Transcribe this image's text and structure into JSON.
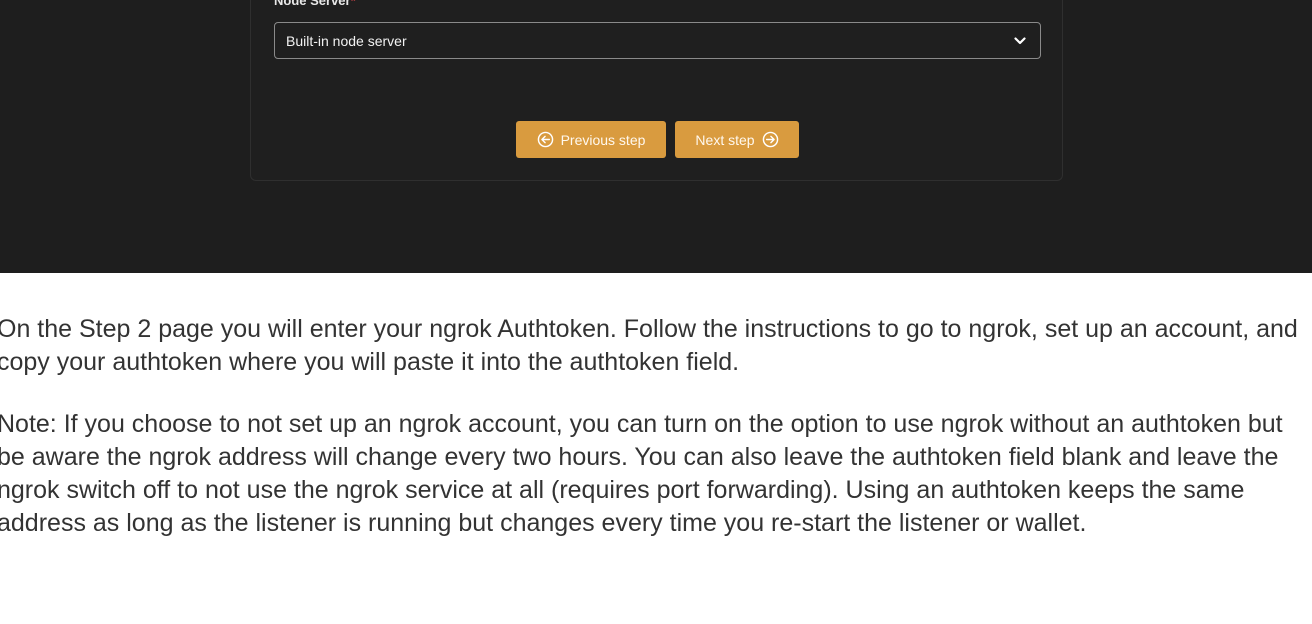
{
  "form": {
    "field_label": "Node Server",
    "required_mark": "*",
    "select": {
      "value": "Built-in node server",
      "icon": "chevron-down-icon"
    },
    "buttons": {
      "previous_label": "Previous step",
      "previous_icon": "arrow-left-circle-icon",
      "next_label": "Next step",
      "next_icon": "arrow-right-circle-icon"
    }
  },
  "article": {
    "paragraph_1": "On the Step 2 page you will enter your ngrok Authtoken. Follow the instructions to go to ngrok, set up an account, and copy your authtoken where you will paste it into the authtoken field.",
    "paragraph_2": "Note: If you choose to not set up an ngrok account, you can turn on the option to use ngrok without an authtoken but be aware the ngrok address will change every two hours. You can also leave the authtoken field blank and leave the ngrok switch off to not use the ngrok service at all (requires port forwarding). Using an authtoken keeps the same address as long as the listener is running but changes every time you re-start the listener or wallet."
  },
  "colors": {
    "screenshot_bg": "#1e1e1e",
    "button_bg": "#d99b3f",
    "required_mark": "#e0474c",
    "article_text": "#333333"
  }
}
